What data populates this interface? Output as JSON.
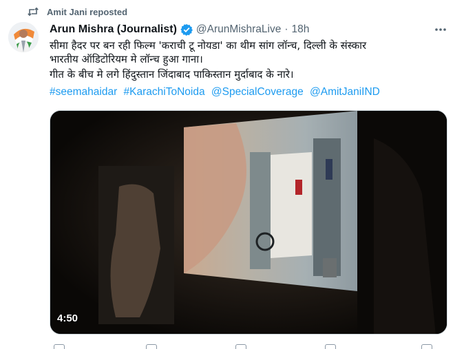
{
  "repost": {
    "label": "Amit Jani reposted",
    "icon": "repost-icon"
  },
  "author": {
    "name": "Arun Mishra (Journalist)",
    "handle": "@ArunMishraLive",
    "separator": "·",
    "time": "18h",
    "verified": true
  },
  "tweet": {
    "line1": "सीमा हैदर पर बन रही फिल्म 'कराची टू नोयडा' का थीम सांग लॉन्च, दिल्ली के संस्कार",
    "line2": "भारतीय ऑडिटोरियम मे लॉन्च हुआ गाना।",
    "line3": " गीत के बीच मे लगे हिंदुस्तान जिंदाबाद पाकिस्तान मुर्दाबाद के नारे।",
    "hashtags": [
      "#seemahaidar",
      "#KarachiToNoida",
      "@SpecialCoverage",
      " @AmitJaniIND"
    ]
  },
  "video": {
    "duration": "4:50"
  },
  "colors": {
    "link": "#1d9bf0",
    "verified": "#1d9bf0",
    "muted": "#536471"
  }
}
